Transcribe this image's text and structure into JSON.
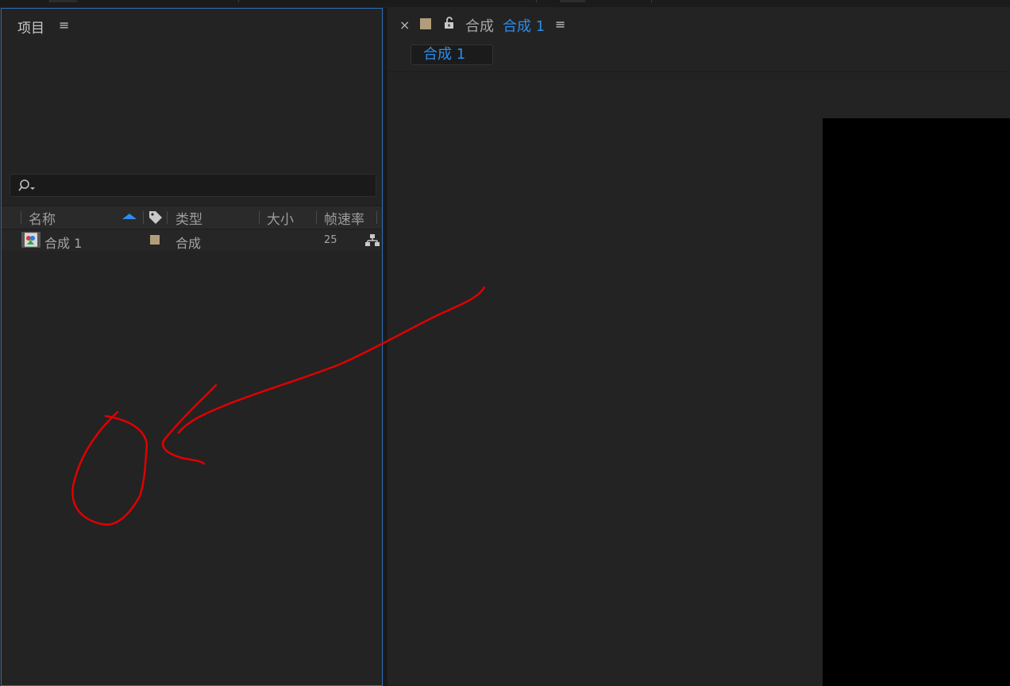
{
  "project_panel": {
    "title": "项目",
    "menu_icon": "hamburger-menu-icon",
    "search": {
      "value": "",
      "icon": "search-icon"
    },
    "columns": {
      "name": "名称",
      "type": "类型",
      "size": "大小",
      "fps": "帧速率"
    },
    "rows": [
      {
        "icon": "composition-icon",
        "name": "合成 1",
        "label_color": "#b29d7a",
        "type": "合成",
        "size": "",
        "fps": "25",
        "flow_icon": "flowchart-icon"
      }
    ]
  },
  "composition_panel": {
    "tab": {
      "close": "×",
      "label_color": "#b29d7a",
      "lock_icon": "unlock-icon",
      "prefix": "合成",
      "name": "合成 1",
      "menu_icon": "hamburger-menu-icon"
    },
    "breadcrumb": "合成 1"
  },
  "colors": {
    "accent": "#2d8ceb",
    "panel_bg": "#232323",
    "focus_border": "#2d6ab3",
    "annotation": "#e00000",
    "viewer_bg": "#000000"
  }
}
